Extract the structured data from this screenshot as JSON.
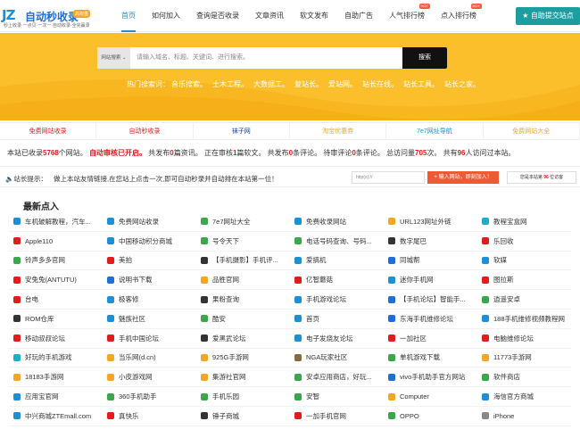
{
  "logo": {
    "mark": "JZ",
    "title": "自动秒收录",
    "badge": "高权重",
    "tagline": "秒上收录·一点贝·一次一·自动收录·全完赢录"
  },
  "nav": [
    {
      "label": "首页",
      "active": true,
      "tag": ""
    },
    {
      "label": "如何加入",
      "active": false,
      "tag": ""
    },
    {
      "label": "查询是否收录",
      "active": false,
      "tag": ""
    },
    {
      "label": "文章资讯",
      "active": false,
      "tag": ""
    },
    {
      "label": "软文发布",
      "active": false,
      "tag": ""
    },
    {
      "label": "自助广告",
      "active": false,
      "tag": ""
    },
    {
      "label": "人气排行榜",
      "active": false,
      "tag": "HOT"
    },
    {
      "label": "点入排行榜",
      "active": false,
      "tag": "HOT"
    }
  ],
  "submit_button": "自助提交站点",
  "search": {
    "select": "网站搜索",
    "placeholder": "请输入域名、标题、关键词、进行搜索。",
    "button": "搜索"
  },
  "hot_words": {
    "label": "热门搜索词：",
    "items": [
      "音乐搜索。",
      "土木工程。",
      "大数据工。",
      "复站长。",
      "爱站网。",
      "站长在线。",
      "站长工具。",
      "站长之家。"
    ]
  },
  "quick_links": [
    {
      "label": "免费网站收录",
      "color": "#e21b1b"
    },
    {
      "label": "自动秒收录",
      "color": "#e21b1b"
    },
    {
      "label": "袜子网",
      "color": "#1a3fa8"
    },
    {
      "label": "淘宝优惠券",
      "color": "#f6a623"
    },
    {
      "label": "7e7网址导航",
      "color": "#1c8fd6"
    },
    {
      "label": "免费网站大全",
      "color": "#f6a623"
    }
  ],
  "stats": {
    "p1": "本站已收录",
    "sites": "5768",
    "p2": "个网站。",
    "audit": "自动审核已开启。",
    "p3": "共发布",
    "articles": "0",
    "p4": "篇资讯。 正在审核",
    "soft": "1",
    "p5": "篇软文。 共发布",
    "comments": "0",
    "p6": "条评论。 待审评论",
    "pending": "0",
    "p7": "条评论。 总访问量",
    "views": "705",
    "p8": "次。 共有",
    "visitors": "96",
    "p9": "人访问过本站。"
  },
  "notice": {
    "label": "站长提示：",
    "text": "做上本站友情链接,在您站上点击一次,即可自动秒录并自动排在本站第一位！",
    "input_placeholder": "http(s)://",
    "add_button": "输入网站，即刻加入！",
    "visit_prefix": "您是本站第",
    "visit_count": "96",
    "visit_suffix": "位访客"
  },
  "list_title": "最新点入",
  "sites": [
    {
      "name": "车机破解教程，汽车...",
      "color": "#1c8fd6"
    },
    {
      "name": "免费网站收录",
      "color": "#1c8fd6"
    },
    {
      "name": "7e7网址大全",
      "color": "#3aa84a"
    },
    {
      "name": "免费收录网站",
      "color": "#1c8fd6"
    },
    {
      "name": "URL123网址外链",
      "color": "#f6a623"
    },
    {
      "name": "教程宝盒网",
      "color": "#1cb0c8"
    },
    {
      "name": "Apple110",
      "color": "#e21b1b"
    },
    {
      "name": "中国移动积分商城",
      "color": "#1c8fd6"
    },
    {
      "name": "号令天下",
      "color": "#3aa84a"
    },
    {
      "name": "电话号码查询、号码...",
      "color": "#3aa84a"
    },
    {
      "name": "数字尾巴",
      "color": "#333333"
    },
    {
      "name": "乐回收",
      "color": "#e21b1b"
    },
    {
      "name": "铃声多多官网",
      "color": "#3aa84a"
    },
    {
      "name": "美拍",
      "color": "#e21b1b"
    },
    {
      "name": "【手机摄影】手机评...",
      "color": "#333333"
    },
    {
      "name": "爱搞机",
      "color": "#1c8fd6"
    },
    {
      "name": "同城帮",
      "color": "#1c6fd6"
    },
    {
      "name": "软媒",
      "color": "#1c8fd6"
    },
    {
      "name": "安兔兔(ANTUTU)",
      "color": "#e21b1b"
    },
    {
      "name": "说明书下载",
      "color": "#1c6fd6"
    },
    {
      "name": "品胜官网",
      "color": "#f6a623"
    },
    {
      "name": "亿智蘑菇",
      "color": "#e21b1b"
    },
    {
      "name": "迷你手机网",
      "color": "#1c8fd6"
    },
    {
      "name": "图拉斯",
      "color": "#e21b1b"
    },
    {
      "name": "台电",
      "color": "#e21b1b"
    },
    {
      "name": "极客修",
      "color": "#1c8fd6"
    },
    {
      "name": "果粉查询",
      "color": "#333333"
    },
    {
      "name": "手机游戏论坛",
      "color": "#1c8fd6"
    },
    {
      "name": "【手机论坛】智能手...",
      "color": "#1c6fd6"
    },
    {
      "name": "逍遥安卓",
      "color": "#3aa84a"
    },
    {
      "name": "ROM仓库",
      "color": "#333333"
    },
    {
      "name": "魅族社区",
      "color": "#1c8fd6"
    },
    {
      "name": "酷安",
      "color": "#3aa84a"
    },
    {
      "name": "首页",
      "color": "#1c8fd6"
    },
    {
      "name": "东海手机维修论坛",
      "color": "#1c6fd6"
    },
    {
      "name": "188手机维修视频教程网",
      "color": "#1c8fd6"
    },
    {
      "name": "移动叔叔论坛",
      "color": "#e21b1b"
    },
    {
      "name": "手机中国论坛",
      "color": "#e21b1b"
    },
    {
      "name": "爱黑武论坛",
      "color": "#333333"
    },
    {
      "name": "电子发烧友论坛",
      "color": "#1c8fd6"
    },
    {
      "name": "一加社区",
      "color": "#e21b1b"
    },
    {
      "name": "电脑维修论坛",
      "color": "#e21b1b"
    },
    {
      "name": "好玩的手机游戏",
      "color": "#1cb0c8"
    },
    {
      "name": "当乐网(d.cn)",
      "color": "#f6a623"
    },
    {
      "name": "925G手游网",
      "color": "#f6a623"
    },
    {
      "name": "NGA玩家社区",
      "color": "#8a6a3a"
    },
    {
      "name": "单机游戏下载",
      "color": "#3aa84a"
    },
    {
      "name": "11773手游网",
      "color": "#f6a623"
    },
    {
      "name": "18183手游网",
      "color": "#f6a623"
    },
    {
      "name": "小皮游戏网",
      "color": "#f6a623"
    },
    {
      "name": "集游社官网",
      "color": "#f6a623"
    },
    {
      "name": "安卓应用商店，好玩...",
      "color": "#3aa84a"
    },
    {
      "name": "vivo手机助手官方网站",
      "color": "#1c6fd6"
    },
    {
      "name": "软件商店",
      "color": "#3aa84a"
    },
    {
      "name": "应用宝官网",
      "color": "#1c8fd6"
    },
    {
      "name": "360手机助手",
      "color": "#3aa84a"
    },
    {
      "name": "手机乐园",
      "color": "#3aa84a"
    },
    {
      "name": "安智",
      "color": "#3aa84a"
    },
    {
      "name": "Computer",
      "color": "#f6a623"
    },
    {
      "name": "海信官方商城",
      "color": "#1c8fd6"
    },
    {
      "name": "中兴商城ZTEmall.com",
      "color": "#1c8fd6"
    },
    {
      "name": "真快乐",
      "color": "#e21b1b"
    },
    {
      "name": "锤子商城",
      "color": "#333333"
    },
    {
      "name": "一加手机官网",
      "color": "#e21b1b"
    },
    {
      "name": "OPPO",
      "color": "#3aa84a"
    },
    {
      "name": "iPhone",
      "color": "#888888"
    }
  ]
}
